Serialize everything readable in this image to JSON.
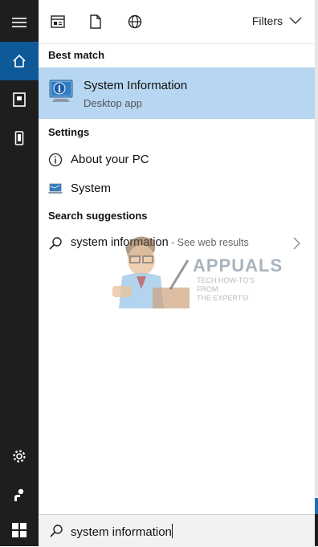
{
  "topbar": {
    "filters_label": "Filters"
  },
  "sections": {
    "best_match": "Best match",
    "settings": "Settings",
    "suggestions": "Search suggestions"
  },
  "best_match": {
    "title": "System Information",
    "subtitle": "Desktop app"
  },
  "settings_items": [
    {
      "label": "About your PC"
    },
    {
      "label": "System"
    }
  ],
  "suggestion": {
    "query": "system information",
    "suffix": " - See web results"
  },
  "watermark": {
    "brand": "APPUALS",
    "tagline1": "TECH HOW-TO'S FROM",
    "tagline2": "THE EXPERTS!"
  },
  "search": {
    "value": "system information"
  },
  "colors": {
    "rail": "#1e1e1e",
    "active": "#0e5a98",
    "highlight": "#b6d6f1"
  }
}
